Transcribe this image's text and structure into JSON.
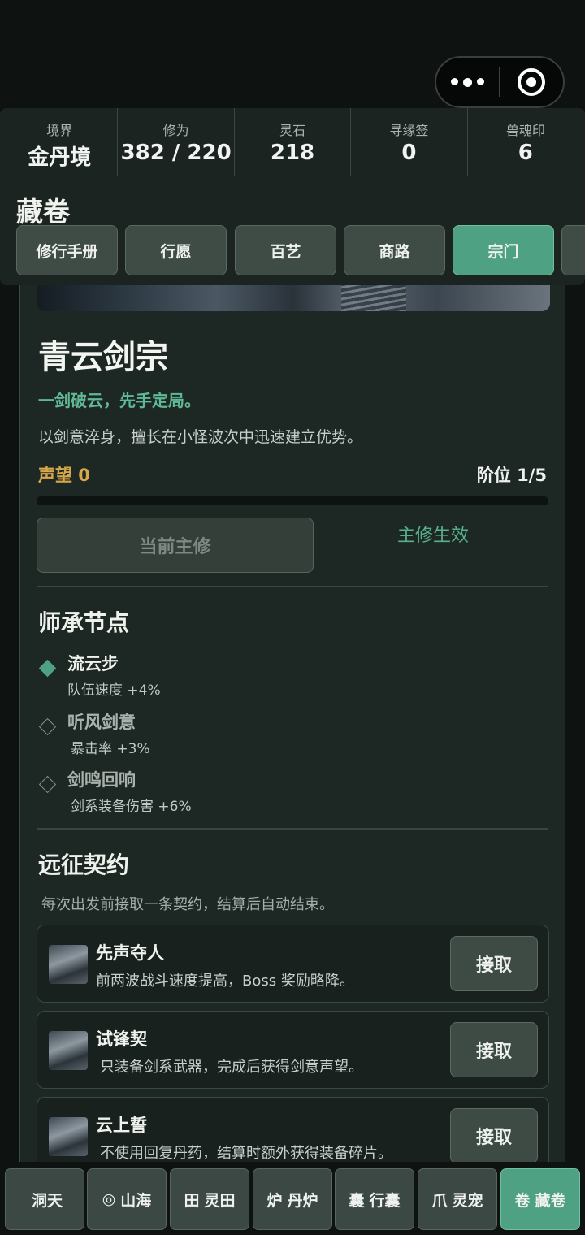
{
  "capsule": {
    "more_icon": "more-dots-icon",
    "close_icon": "target-circle-icon"
  },
  "stats": [
    {
      "label": "境界",
      "value": "金丹境"
    },
    {
      "label": "修为",
      "value": "382 / 220"
    },
    {
      "label": "灵石",
      "value": "218"
    },
    {
      "label": "寻缘签",
      "value": "0"
    },
    {
      "label": "兽魂印",
      "value": "6"
    }
  ],
  "section_title": "藏卷",
  "tabs": [
    "修行手册",
    "行愿",
    "百艺",
    "商路",
    "宗门"
  ],
  "active_tab": "宗门",
  "sect": {
    "name": "青云剑宗",
    "motto": "一剑破云，先手定局。",
    "description": "以剑意淬身，擅长在小怪波次中迅速建立优势。",
    "prestige_label": "声望 0",
    "rank_label": "阶位 1/5",
    "progress": 0,
    "main_button": "当前主修",
    "effect_label": "主修生效"
  },
  "mentor": {
    "title": "师承节点",
    "nodes": [
      {
        "name": "流云步",
        "bonus": "队伍速度 +4%",
        "unlocked": true
      },
      {
        "name": "听风剑意",
        "bonus": "暴击率 +3%",
        "unlocked": false
      },
      {
        "name": "剑鸣回响",
        "bonus": "剑系装备伤害 +6%",
        "unlocked": false
      }
    ]
  },
  "contracts": {
    "title": "远征契约",
    "hint": "每次出发前接取一条契约，结算后自动结束。",
    "items": [
      {
        "name": "先声夺人",
        "desc": "前两波战斗速度提高，Boss 奖励略降。",
        "button": "接取"
      },
      {
        "name": "试锋契",
        "desc": "只装备剑系武器，完成后获得剑意声望。",
        "button": "接取"
      },
      {
        "name": "云上誓",
        "desc": "不使用回复丹药，结算时额外获得装备碎片。",
        "button": "接取"
      }
    ]
  },
  "bottom_nav": [
    {
      "icon": "",
      "label": "洞天"
    },
    {
      "icon": "◎",
      "label": "山海"
    },
    {
      "icon": "田",
      "label": "灵田"
    },
    {
      "icon": "炉",
      "label": "丹炉"
    },
    {
      "icon": "囊",
      "label": "行囊"
    },
    {
      "icon": "爪",
      "label": "灵宠"
    },
    {
      "icon": "卷",
      "label": "藏卷"
    }
  ],
  "colors": {
    "accent": "#4ea283",
    "gold": "#d8a94a",
    "panel": "#1d2723"
  }
}
